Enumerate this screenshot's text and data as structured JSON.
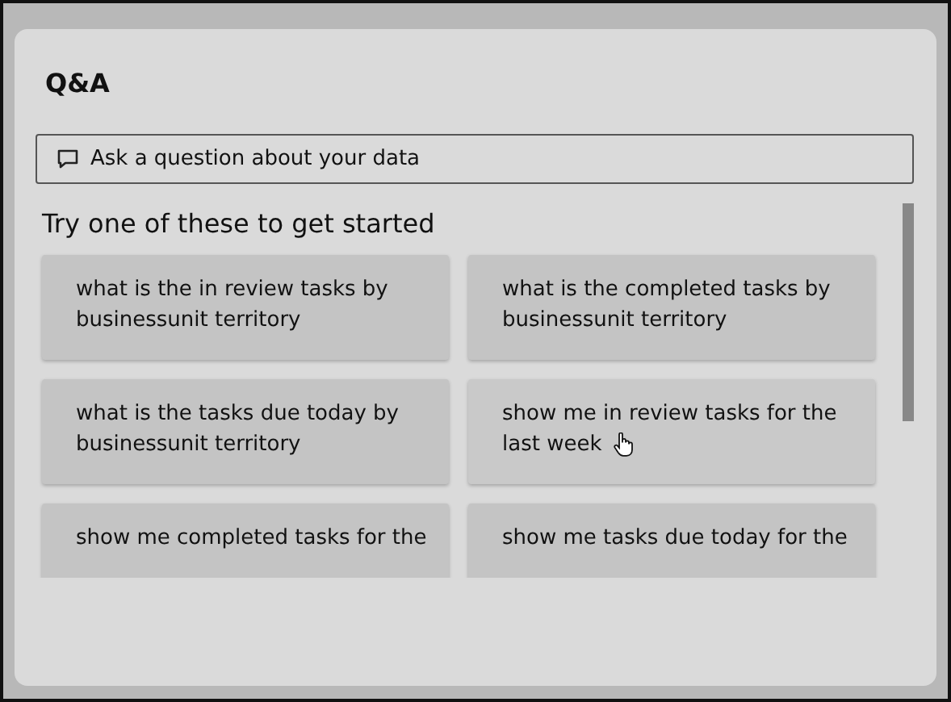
{
  "panel": {
    "title": "Q&A"
  },
  "search": {
    "placeholder": "Ask a question about your data"
  },
  "suggestions": {
    "heading": "Try one of these to get started",
    "items": [
      {
        "text": "what is the in review tasks by businessunit territory",
        "hovered": false
      },
      {
        "text": "what is the completed tasks by businessunit territory",
        "hovered": false
      },
      {
        "text": "what is the tasks due today by businessunit territory",
        "hovered": false
      },
      {
        "text": "show me in review tasks for the last week",
        "hovered": true
      },
      {
        "text": "show me completed tasks for the",
        "hovered": false
      },
      {
        "text": "show me tasks due today for the",
        "hovered": false
      }
    ]
  }
}
